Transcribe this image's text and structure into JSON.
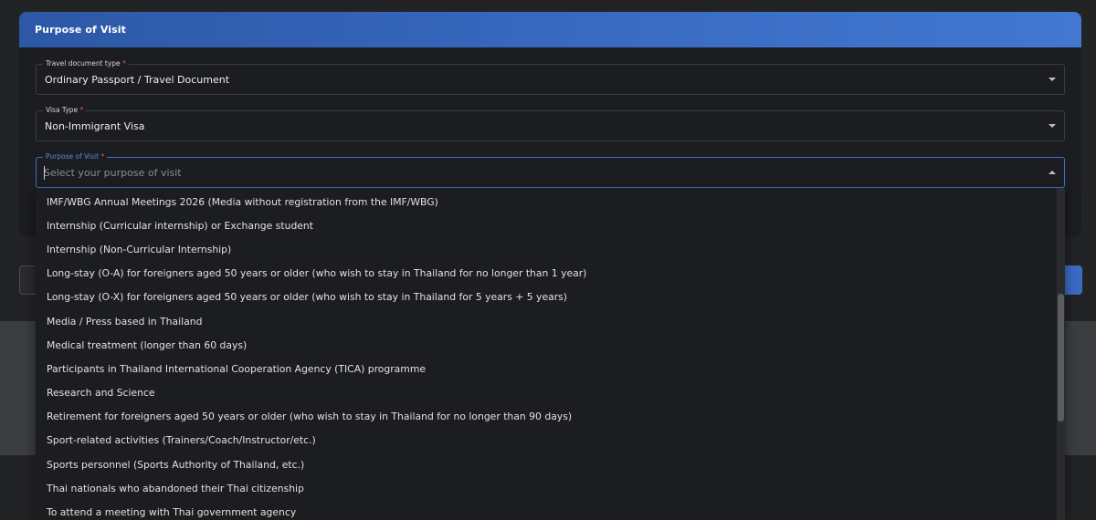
{
  "card": {
    "title": "Purpose of Visit"
  },
  "fields": {
    "travel_document": {
      "label": "Travel document type",
      "required_mark": "*",
      "value": "Ordinary Passport / Travel Document"
    },
    "visa_type": {
      "label": "Visa Type",
      "required_mark": "*",
      "value": "Non-Immigrant Visa"
    },
    "purpose": {
      "label": "Purpose of Visit",
      "required_mark": "*",
      "placeholder": "Select your purpose of visit"
    }
  },
  "dropdown": {
    "options": [
      "IMF/WBG Annual Meetings 2026 (Media without registration from the IMF/WBG)",
      "Internship (Curricular internship) or Exchange student",
      "Internship (Non-Curricular Internship)",
      "Long-stay (O-A) for foreigners aged 50 years or older (who wish to stay in Thailand for no longer than 1 year)",
      "Long-stay (O-X) for foreigners aged 50 years or older (who wish to stay in Thailand for 5 years + 5 years)",
      "Media / Press based in Thailand",
      "Medical treatment (longer than 60 days)",
      "Participants in Thailand International Cooperation Agency (TICA) programme",
      "Research and Science",
      "Retirement for foreigners aged 50 years or older (who wish to stay in Thailand for no longer than 90 days)",
      "Sport-related activities (Trainers/Coach/Instructor/etc.)",
      "Sports personnel (Sports Authority of Thailand, etc.)",
      "Thai nationals who abandoned their Thai citizenship",
      "To attend a meeting with Thai government agency"
    ]
  },
  "colors": {
    "header_accent": "#3a6cc4",
    "required": "#e05a5a",
    "focus": "#3f6fc9"
  }
}
